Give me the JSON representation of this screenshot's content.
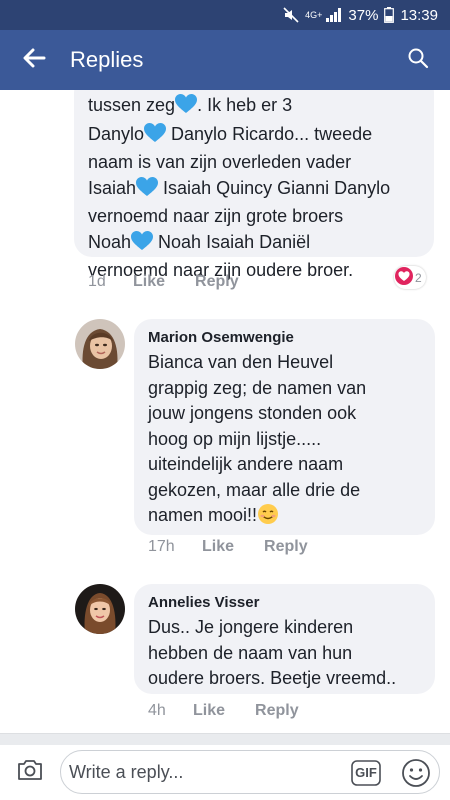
{
  "status_bar": {
    "network": "4G+",
    "battery": "37%",
    "time": "13:39"
  },
  "header": {
    "title": "Replies",
    "back_icon": "back-arrow-icon",
    "search_icon": "search-icon"
  },
  "comments": [
    {
      "author": "",
      "text_parts": [
        "tussen zeg",
        ". Ik heb er 3\nDanylo",
        " Danylo Ricardo... tweede\nnaam is van zijn overleden vader\nIsaiah",
        " Isaiah Quincy Gianni Danylo\nvernoemd naar zijn grote broers\nNoah",
        " Noah Isaiah Daniël\nvernoemd naar zijn oudere broer."
      ],
      "time": "1d",
      "like_label": "Like",
      "reply_label": "Reply",
      "reaction_icon": "heart-reaction-icon",
      "reaction_count": "2"
    },
    {
      "author": "Marion Osemwengie",
      "text": "Bianca van den Heuvel\ngrappig zeg; de namen van\njouw jongens stonden ook\nhoog op mijn lijstje.....\nuiteindelijk andere naam\ngekozen, maar alle drie de\nnamen mooi!!",
      "time": "17h",
      "like_label": "Like",
      "reply_label": "Reply"
    },
    {
      "author": "Annelies Visser",
      "text": "Dus.. Je jongere kinderen\nhebben de naam van hun\noudere broers. Beetje vreemd..",
      "time": "4h",
      "like_label": "Like",
      "reply_label": "Reply"
    }
  ],
  "composer": {
    "placeholder": "Write a reply...",
    "value": "",
    "gif_label": "GIF",
    "camera_icon": "camera-icon",
    "emoji_icon": "emoji-icon"
  },
  "colors": {
    "status_bar": "#2d4373",
    "header": "#3b5998",
    "bubble": "#f1f2f6",
    "meta_text": "#90949c",
    "heart_blue": "#3ba4e8",
    "heart_red": "#e0245e"
  }
}
